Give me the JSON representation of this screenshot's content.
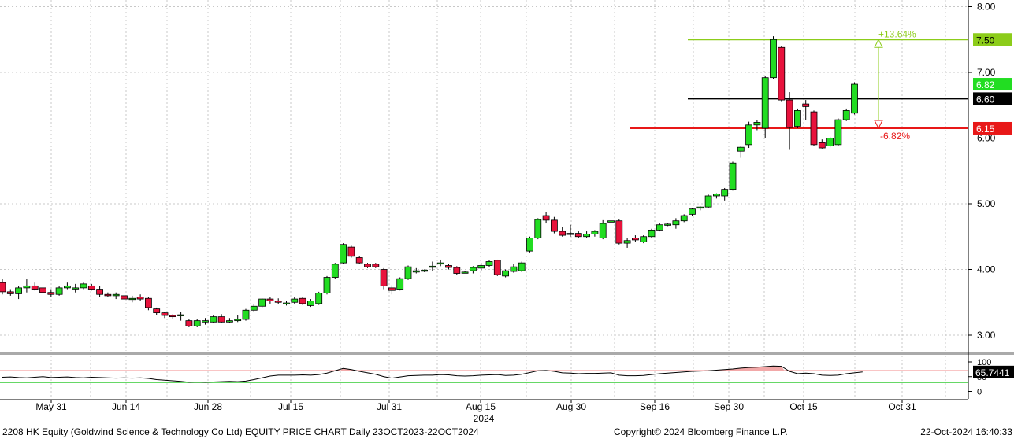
{
  "footer": {
    "left": "2208 HK Equity (Goldwind Science & Technology Co Ltd) EQUITY PRICE CHART  Daily 23OCT2023-22OCT2024",
    "center": "Copyright© 2024 Bloomberg Finance L.P.",
    "right": "22-Oct-2024 16:40:33"
  },
  "colors": {
    "up": "#22dd22",
    "down": "#e8123c",
    "grid": "#c8c8c8",
    "resistance": "#8ccc1a",
    "support": "#e81818",
    "pivot": "#000000",
    "rsi_fill": "#f2a8a8"
  },
  "chart_data": [
    {
      "type": "candlestick",
      "ylim": [
        2.8,
        8.1
      ],
      "y_ticks": [
        "8.00",
        "7.00",
        "6.00",
        "5.00",
        "4.00",
        "3.00"
      ],
      "x_tick_labels": [
        "May 31",
        "Jun 14",
        "Jun 28",
        "Jul 15",
        "Jul 31",
        "Aug 15",
        "Aug 30",
        "Sep 16",
        "Sep 30",
        "Oct 15",
        "Oct 31"
      ],
      "x_year_label": "2024",
      "grid": true,
      "candles": [
        [
          3.8,
          3.85,
          3.62,
          3.66
        ],
        [
          3.66,
          3.7,
          3.6,
          3.63
        ],
        [
          3.63,
          3.75,
          3.55,
          3.72
        ],
        [
          3.72,
          3.85,
          3.65,
          3.75
        ],
        [
          3.75,
          3.8,
          3.68,
          3.7
        ],
        [
          3.72,
          3.75,
          3.62,
          3.65
        ],
        [
          3.65,
          3.7,
          3.58,
          3.62
        ],
        [
          3.62,
          3.75,
          3.6,
          3.72
        ],
        [
          3.72,
          3.8,
          3.7,
          3.75
        ],
        [
          3.72,
          3.78,
          3.65,
          3.72
        ],
        [
          3.72,
          3.8,
          3.7,
          3.78
        ],
        [
          3.75,
          3.78,
          3.68,
          3.7
        ],
        [
          3.7,
          3.75,
          3.58,
          3.62
        ],
        [
          3.62,
          3.65,
          3.58,
          3.6
        ],
        [
          3.6,
          3.65,
          3.55,
          3.62
        ],
        [
          3.6,
          3.62,
          3.52,
          3.55
        ],
        [
          3.55,
          3.6,
          3.5,
          3.56
        ],
        [
          3.58,
          3.62,
          3.52,
          3.55
        ],
        [
          3.56,
          3.58,
          3.38,
          3.42
        ],
        [
          3.4,
          3.42,
          3.3,
          3.34
        ],
        [
          3.34,
          3.36,
          3.26,
          3.3
        ],
        [
          3.3,
          3.32,
          3.25,
          3.28
        ],
        [
          3.31,
          3.35,
          3.22,
          3.31
        ],
        [
          3.22,
          3.25,
          3.12,
          3.14
        ],
        [
          3.14,
          3.24,
          3.12,
          3.22
        ],
        [
          3.2,
          3.26,
          3.16,
          3.22
        ],
        [
          3.2,
          3.3,
          3.18,
          3.28
        ],
        [
          3.28,
          3.32,
          3.18,
          3.2
        ],
        [
          3.2,
          3.26,
          3.18,
          3.22
        ],
        [
          3.22,
          3.3,
          3.2,
          3.24
        ],
        [
          3.24,
          3.4,
          3.22,
          3.38
        ],
        [
          3.38,
          3.48,
          3.36,
          3.44
        ],
        [
          3.44,
          3.56,
          3.42,
          3.55
        ],
        [
          3.55,
          3.58,
          3.48,
          3.52
        ],
        [
          3.52,
          3.56,
          3.47,
          3.5
        ],
        [
          3.48,
          3.52,
          3.45,
          3.49
        ],
        [
          3.5,
          3.58,
          3.48,
          3.55
        ],
        [
          3.56,
          3.58,
          3.46,
          3.48
        ],
        [
          3.45,
          3.55,
          3.43,
          3.52
        ],
        [
          3.48,
          3.66,
          3.46,
          3.64
        ],
        [
          3.64,
          3.9,
          3.62,
          3.88
        ],
        [
          3.88,
          4.1,
          3.86,
          4.08
        ],
        [
          4.1,
          4.4,
          4.08,
          4.38
        ],
        [
          4.34,
          4.36,
          4.18,
          4.2
        ],
        [
          4.18,
          4.2,
          4.08,
          4.1
        ],
        [
          4.08,
          4.1,
          4.02,
          4.04
        ],
        [
          4.08,
          4.1,
          4.02,
          4.04
        ],
        [
          4.0,
          4.02,
          3.7,
          3.75
        ],
        [
          3.72,
          3.76,
          3.62,
          3.68
        ],
        [
          3.7,
          3.88,
          3.68,
          3.86
        ],
        [
          3.86,
          4.06,
          3.84,
          4.04
        ],
        [
          3.96,
          4.02,
          3.94,
          3.98
        ],
        [
          3.98,
          4.0,
          3.96,
          3.99
        ],
        [
          4.05,
          4.12,
          3.98,
          4.05
        ],
        [
          4.1,
          4.15,
          4.05,
          4.1
        ],
        [
          4.06,
          4.08,
          4.0,
          4.03
        ],
        [
          4.03,
          4.05,
          3.92,
          3.94
        ],
        [
          3.96,
          3.98,
          3.94,
          3.96
        ],
        [
          3.98,
          4.05,
          3.94,
          4.03
        ],
        [
          4.02,
          4.1,
          3.98,
          4.06
        ],
        [
          4.06,
          4.15,
          4.04,
          4.12
        ],
        [
          4.14,
          4.15,
          3.9,
          3.92
        ],
        [
          3.9,
          4.0,
          3.88,
          3.98
        ],
        [
          3.97,
          4.08,
          3.95,
          4.04
        ],
        [
          3.98,
          4.12,
          3.96,
          4.1
        ],
        [
          4.28,
          4.5,
          4.26,
          4.48
        ],
        [
          4.48,
          4.78,
          4.46,
          4.76
        ],
        [
          4.82,
          4.88,
          4.7,
          4.75
        ],
        [
          4.75,
          4.8,
          4.55,
          4.58
        ],
        [
          4.58,
          4.65,
          4.5,
          4.52
        ],
        [
          4.55,
          4.68,
          4.5,
          4.55
        ],
        [
          4.55,
          4.58,
          4.48,
          4.5
        ],
        [
          4.5,
          4.58,
          4.48,
          4.54
        ],
        [
          4.54,
          4.6,
          4.5,
          4.58
        ],
        [
          4.48,
          4.75,
          4.46,
          4.7
        ],
        [
          4.72,
          4.76,
          4.7,
          4.74
        ],
        [
          4.74,
          4.76,
          4.38,
          4.4
        ],
        [
          4.4,
          4.48,
          4.33,
          4.44
        ],
        [
          4.48,
          4.52,
          4.42,
          4.45
        ],
        [
          4.42,
          4.52,
          4.4,
          4.5
        ],
        [
          4.5,
          4.62,
          4.48,
          4.6
        ],
        [
          4.6,
          4.7,
          4.58,
          4.68
        ],
        [
          4.68,
          4.7,
          4.66,
          4.69
        ],
        [
          4.68,
          4.78,
          4.62,
          4.74
        ],
        [
          4.74,
          4.84,
          4.72,
          4.82
        ],
        [
          4.84,
          4.94,
          4.82,
          4.92
        ],
        [
          4.94,
          4.96,
          4.9,
          4.95
        ],
        [
          4.95,
          5.14,
          4.93,
          5.12
        ],
        [
          5.12,
          5.16,
          5.08,
          5.15
        ],
        [
          5.12,
          5.24,
          5.05,
          5.22
        ],
        [
          5.22,
          5.64,
          5.2,
          5.62
        ],
        [
          5.8,
          5.88,
          5.7,
          5.86
        ],
        [
          5.9,
          6.25,
          5.85,
          6.2
        ],
        [
          6.2,
          6.28,
          6.12,
          6.24
        ],
        [
          6.15,
          6.95,
          6.0,
          6.92
        ],
        [
          6.92,
          7.55,
          6.9,
          7.5
        ],
        [
          7.38,
          7.4,
          6.55,
          6.58
        ],
        [
          6.58,
          6.7,
          5.82,
          6.16
        ],
        [
          6.18,
          6.45,
          6.15,
          6.42
        ],
        [
          6.52,
          6.58,
          6.28,
          6.48
        ],
        [
          6.4,
          6.42,
          5.88,
          5.9
        ],
        [
          5.93,
          5.98,
          5.84,
          5.85
        ],
        [
          5.88,
          6.02,
          5.86,
          6.0
        ],
        [
          5.9,
          6.3,
          5.88,
          6.28
        ],
        [
          6.28,
          6.45,
          6.26,
          6.42
        ],
        [
          6.38,
          6.85,
          6.36,
          6.82
        ]
      ],
      "horizontal_lines": [
        {
          "value": 7.5,
          "label": "7.50",
          "color_key": "resistance"
        },
        {
          "value": 6.6,
          "label": "6.60",
          "color_key": "pivot"
        },
        {
          "value": 6.15,
          "label": "6.15",
          "color_key": "support"
        }
      ],
      "last_price": {
        "value": 6.82,
        "label": "6.82"
      },
      "annotations": [
        {
          "text": "+13.64%",
          "at": 7.5
        },
        {
          "text": "-6.82%",
          "at": 6.15
        }
      ]
    },
    {
      "type": "line",
      "ylim": [
        -10,
        110
      ],
      "y_ticks": [
        "100",
        "50",
        "0"
      ],
      "overbought": 70,
      "oversold": 30,
      "last_value": 65.7441,
      "last_label": "65.7441",
      "values": [
        48,
        49,
        47,
        46,
        48,
        50,
        47,
        48,
        49,
        47,
        46,
        48,
        47,
        46,
        45,
        46,
        45,
        46,
        44,
        40,
        38,
        36,
        34,
        31,
        32,
        31,
        32,
        33,
        34,
        33,
        35,
        40,
        46,
        52,
        55,
        55,
        55,
        56,
        55,
        57,
        62,
        70,
        78,
        74,
        68,
        63,
        58,
        50,
        45,
        49,
        53,
        54,
        55,
        55,
        57,
        56,
        53,
        52,
        53,
        55,
        56,
        57,
        54,
        55,
        58,
        64,
        70,
        71,
        68,
        63,
        62,
        60,
        61,
        61,
        62,
        63,
        55,
        53,
        53,
        54,
        57,
        60,
        62,
        64,
        66,
        68,
        69,
        70,
        72,
        74,
        76,
        79,
        81,
        82,
        84,
        86,
        85,
        68,
        60,
        62,
        60,
        55,
        54,
        55,
        60,
        63,
        66
      ]
    }
  ]
}
